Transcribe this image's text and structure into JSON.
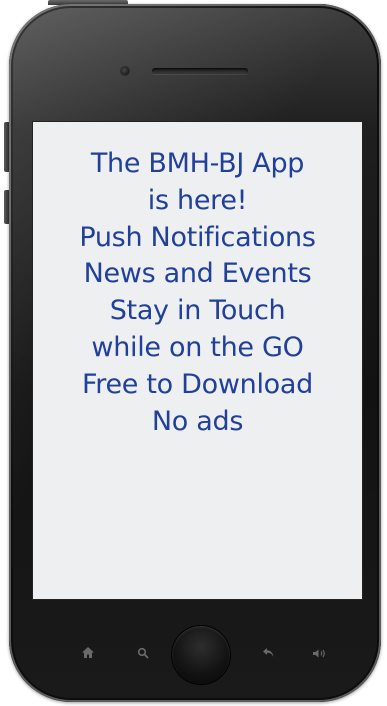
{
  "screen": {
    "lines": [
      "The BMH-BJ App",
      "is here!",
      "Push Notifications",
      "News and Events",
      "Stay in Touch",
      "while on the GO",
      "Free to Download",
      "No ads"
    ],
    "text_color": "#20409a",
    "background_color": "#edeff0"
  },
  "nav_icons": {
    "home": "home-icon",
    "search": "search-icon",
    "main_button": "home-button",
    "back": "back-arrow-icon",
    "volume": "volume-icon"
  }
}
